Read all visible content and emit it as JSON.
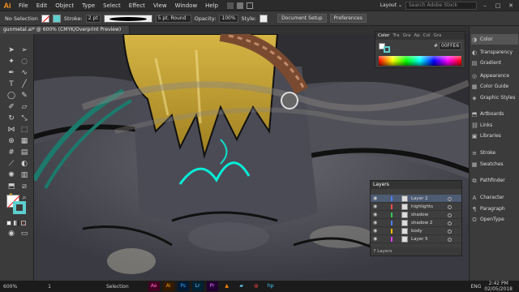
{
  "app": {
    "logo": "Ai"
  },
  "menu": [
    "File",
    "Edit",
    "Object",
    "Type",
    "Select",
    "Effect",
    "View",
    "Window",
    "Help"
  ],
  "workspace": {
    "layout_label": "Layout ⌄",
    "search_placeholder": "Search Adobe Stock"
  },
  "window_controls": {
    "min": "–",
    "max": "□",
    "close": "✕"
  },
  "control_bar": {
    "selection_label": "No Selection",
    "stroke_label": "Stroke:",
    "stroke_weight": "2 pt",
    "brush_label": "5 pt. Round",
    "opacity_label": "Opacity:",
    "opacity_value": "100%",
    "style_label": "Style:",
    "doc_setup_button": "Document Setup",
    "preferences_button": "Preferences"
  },
  "document_tab": "gunmetal.ai* @ 600% (CMYK/Overprint Preview)",
  "color_panel": {
    "tabs": [
      "Color",
      "Tra",
      "Gra",
      "Ap",
      "Col",
      "Gra"
    ],
    "hex_prefix": "#",
    "hex_value": "00FFE6"
  },
  "right_dock": [
    {
      "label": "Color",
      "icon": "color-icon"
    },
    {
      "label": "Transparency",
      "icon": "transparency-icon"
    },
    {
      "label": "Gradient",
      "icon": "gradient-icon"
    },
    {
      "label": "Appearance",
      "icon": "appearance-icon"
    },
    {
      "label": "Color Guide",
      "icon": "color-guide-icon"
    },
    {
      "label": "Graphic Styles",
      "icon": "graphic-styles-icon"
    },
    {
      "label": "Artboards",
      "icon": "artboards-icon"
    },
    {
      "label": "Links",
      "icon": "links-icon"
    },
    {
      "label": "Libraries",
      "icon": "libraries-icon"
    },
    {
      "label": "Stroke",
      "icon": "stroke-icon"
    },
    {
      "label": "Swatches",
      "icon": "swatches-icon"
    },
    {
      "label": "Pathfinder",
      "icon": "pathfinder-icon"
    },
    {
      "label": "Character",
      "icon": "character-icon"
    },
    {
      "label": "Paragraph",
      "icon": "paragraph-icon"
    },
    {
      "label": "OpenType",
      "icon": "opentype-icon"
    }
  ],
  "layers_panel": {
    "title": "Layers",
    "layers": [
      {
        "name": "Layer 2",
        "color": "#4f7fff",
        "selected": true
      },
      {
        "name": "highlights",
        "color": "#ff4d4d",
        "selected": false
      },
      {
        "name": "shadow",
        "color": "#34c759",
        "selected": false
      },
      {
        "name": "shadow 2",
        "color": "#4f7fff",
        "selected": false
      },
      {
        "name": "body",
        "color": "#f0c000",
        "selected": false
      },
      {
        "name": "Layer 5",
        "color": "#e040fb",
        "selected": false
      }
    ],
    "footer": "7 Layers"
  },
  "status": {
    "zoom": "600%",
    "page": "1",
    "mode": "Selection",
    "time": "2:42 PM",
    "date": "02/05/2018",
    "lang": "ENG"
  },
  "accent": "#00FFE6"
}
